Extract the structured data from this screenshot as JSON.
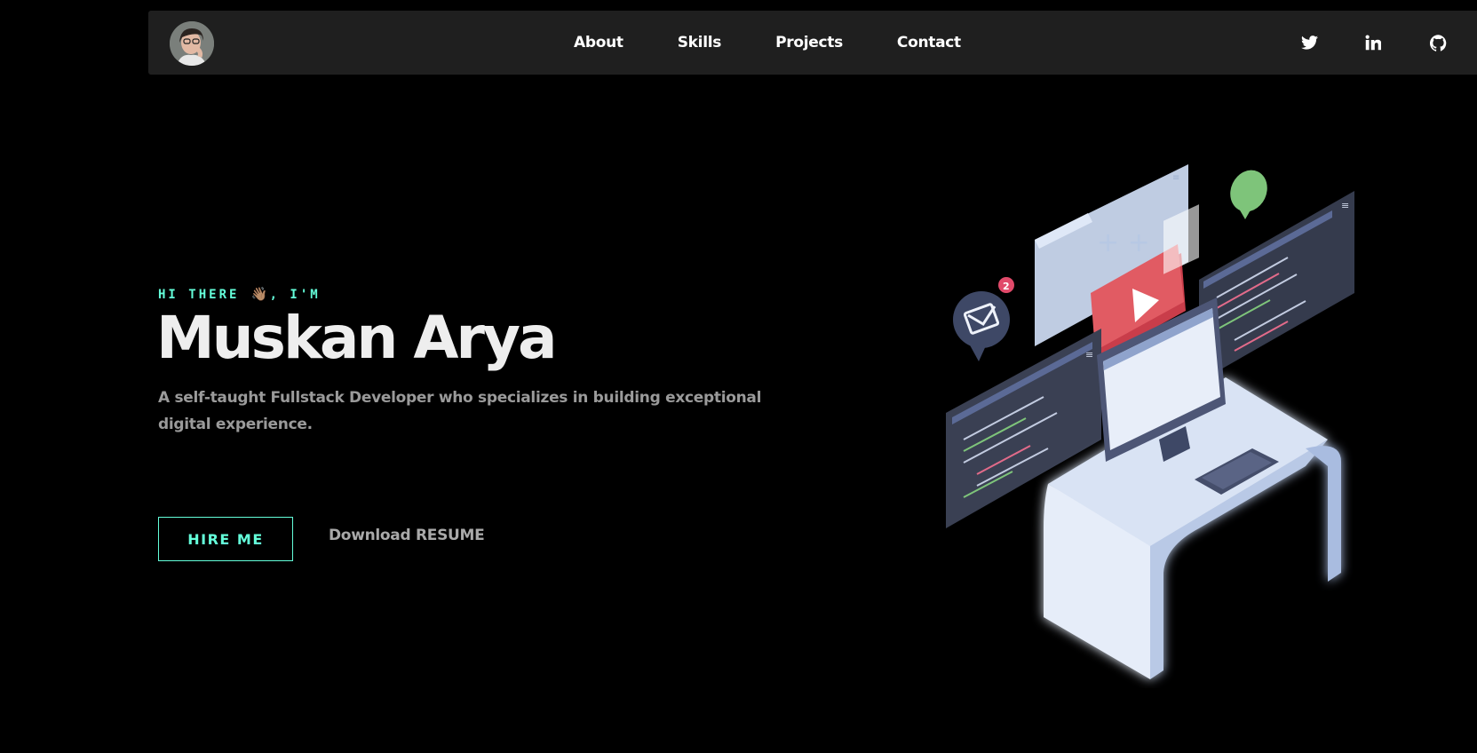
{
  "nav": {
    "links": [
      {
        "label": "About"
      },
      {
        "label": "Skills"
      },
      {
        "label": "Projects"
      },
      {
        "label": "Contact"
      }
    ],
    "social_icons": [
      "twitter-icon",
      "linkedin-icon",
      "github-icon"
    ]
  },
  "hero": {
    "greeting_prefix": "HI THERE",
    "wave": "👋🏽",
    "greeting_suffix": ", I'M",
    "name": "Muskan Arya",
    "description": "A self-taught Fullstack Developer who specializes in building exceptional digital experience.",
    "hire_label": "HIRE ME",
    "resume_label": "Download RESUME"
  },
  "illustration": {
    "notification_count": "2"
  },
  "colors": {
    "background": "#000000",
    "navbar": "#1f1f1f",
    "accent": "#64ffda",
    "muted_text": "#9a9a9a"
  }
}
